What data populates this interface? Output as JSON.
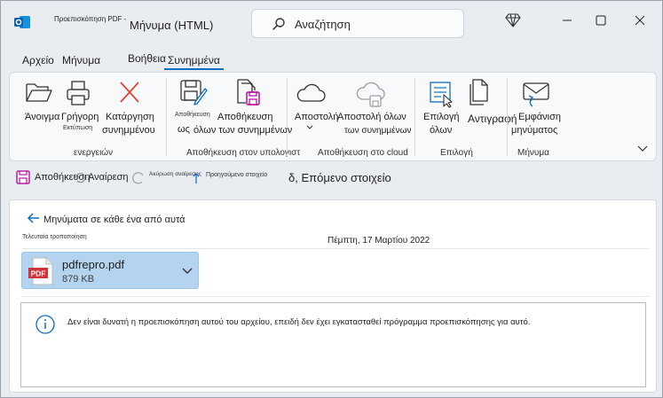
{
  "titlebar": {
    "small_title": "Προεπισκόπηση PDF -",
    "title": "Μήνυμα (HTML)",
    "search_placeholder": "Αναζήτηση"
  },
  "tabs": [
    {
      "label": "Αρχείο"
    },
    {
      "label": "Μήνυμα"
    },
    {
      "label": "Βοήθεια"
    },
    {
      "label": "Συνημμένα",
      "active": true
    }
  ],
  "ribbon": {
    "open": "Άνοιγμα",
    "quick_print": "Γρήγορη",
    "quick_print_sub": "Εκτύπωση",
    "remove_line1": "Κατάργηση",
    "remove_line2": "συνημμένου",
    "group_actions": "ενεργειών",
    "save_as_small": "Αποθήκευση",
    "save_as_main": "ως",
    "save_all_line1": "Αποθήκευση",
    "save_all_line2": "όλων των συνημμένων",
    "group_save_pc": "Αποθήκευση στον υπολογιστ",
    "send": "Αποστολή",
    "send_all_line1": "Αποστολή όλων",
    "send_all_line2": "των συνημμένων",
    "group_cloud": "Αποθήκευση στο cloud",
    "select_all_line1": "Επιλογή",
    "select_all_line2": "όλων",
    "copy": "Αντιγραφή",
    "group_select": "Επιλογή",
    "show_msg_line1": "Εμφάνιση",
    "show_msg_line2": "μηνύματος",
    "group_message": "Μήνυμα"
  },
  "quickbar": {
    "save": "Αποθήκευση",
    "undo": "Αναίρεση",
    "undo_tiny": "Ακύρωση αναίρεσης",
    "prev_tiny": "Προηγούμενο στοιχείο",
    "next": "δ, Επόμενο στοιχείο"
  },
  "content": {
    "back_label": "Μηνύματα σε κάθε ένα από αυτά",
    "last_modified": "Τελευταία τροποποίηση",
    "date": "Πέμπτη, 17 Μαρτίου 2022",
    "attachment": {
      "name": "pdfrepro.pdf",
      "size": "879 KB",
      "icon_text": "PDF"
    },
    "info": "Δεν είναι δυνατή η προεπισκόπηση αυτού του αρχείου, επειδή δεν έχει εγκατασταθεί πρόγραμμα προεπισκόπησης για αυτό."
  },
  "colors": {
    "accent": "#0f6cbd",
    "attachment_bg": "#b3d3ee",
    "pdf_red": "#d13438"
  }
}
